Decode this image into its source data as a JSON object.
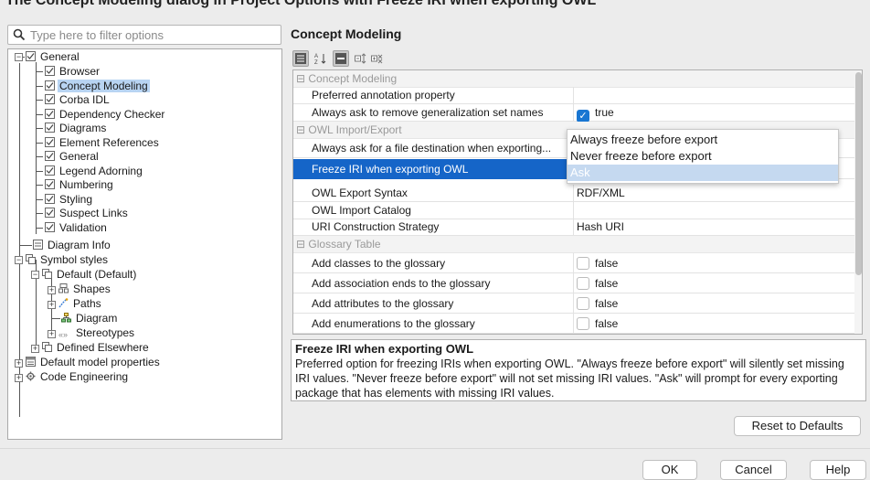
{
  "dialog": {
    "title": "The Concept Modeling dialog in Project Options with Freeze IRI when exporting OWL"
  },
  "filter": {
    "placeholder": "Type here to filter options"
  },
  "tree": {
    "general": "General",
    "general_children": [
      "Browser",
      "Concept Modeling",
      "Corba IDL",
      "Dependency Checker",
      "Diagrams",
      "Element References",
      "General",
      "Legend Adorning",
      "Numbering",
      "Styling",
      "Suspect Links",
      "Validation"
    ],
    "diagram_info": "Diagram Info",
    "symbol_styles": "Symbol styles",
    "default_default": "Default (Default)",
    "shapes": "Shapes",
    "paths": "Paths",
    "diagram": "Diagram",
    "stereotypes": "Stereotypes",
    "defined_elsewhere": "Defined Elsewhere",
    "default_model_properties": "Default model properties",
    "code_engineering": "Code Engineering",
    "selected": "Concept Modeling"
  },
  "panel": {
    "title": "Concept Modeling"
  },
  "grid": {
    "group_concept": "Concept Modeling",
    "preferred_annotation": "Preferred annotation property",
    "always_ask_remove": "Always ask to remove generalization set names",
    "always_ask_remove_val": "true",
    "group_owl": "OWL Import/Export",
    "always_ask_file": "Always ask for a file destination when exporting...",
    "freeze_iri": "Freeze IRI when exporting OWL",
    "owl_export_syntax": "OWL Export Syntax",
    "owl_export_syntax_val": "RDF/XML",
    "owl_import_catalog": "OWL Import Catalog",
    "uri_construction": "URI Construction Strategy",
    "uri_construction_val": "Hash URI",
    "group_glossary": "Glossary Table",
    "add_classes": "Add classes to the glossary",
    "add_classes_val": "false",
    "add_assoc": "Add association ends to the glossary",
    "add_assoc_val": "false",
    "add_attrs": "Add attributes to the glossary",
    "add_attrs_val": "false",
    "add_enums": "Add enumerations to the glossary",
    "add_enums_val": "false"
  },
  "dropdown": {
    "options": [
      "Always freeze before export",
      "Never freeze before export",
      "Ask"
    ],
    "selected": "Ask"
  },
  "description": {
    "title": "Freeze IRI when exporting OWL",
    "text": "Preferred option for freezing IRIs when exporting OWL. \"Always freeze before export\" will silently set missing IRI values. \"Never freeze before export\" will not set missing IRI values. \"Ask\" will prompt for every exporting package that has elements with missing IRI values."
  },
  "buttons": {
    "reset": "Reset to Defaults",
    "ok": "OK",
    "cancel": "Cancel",
    "help": "Help"
  },
  "colors": {
    "selection": "#1565c8",
    "tree_selection": "#b8d4f2",
    "checkbox": "#1976d2"
  }
}
